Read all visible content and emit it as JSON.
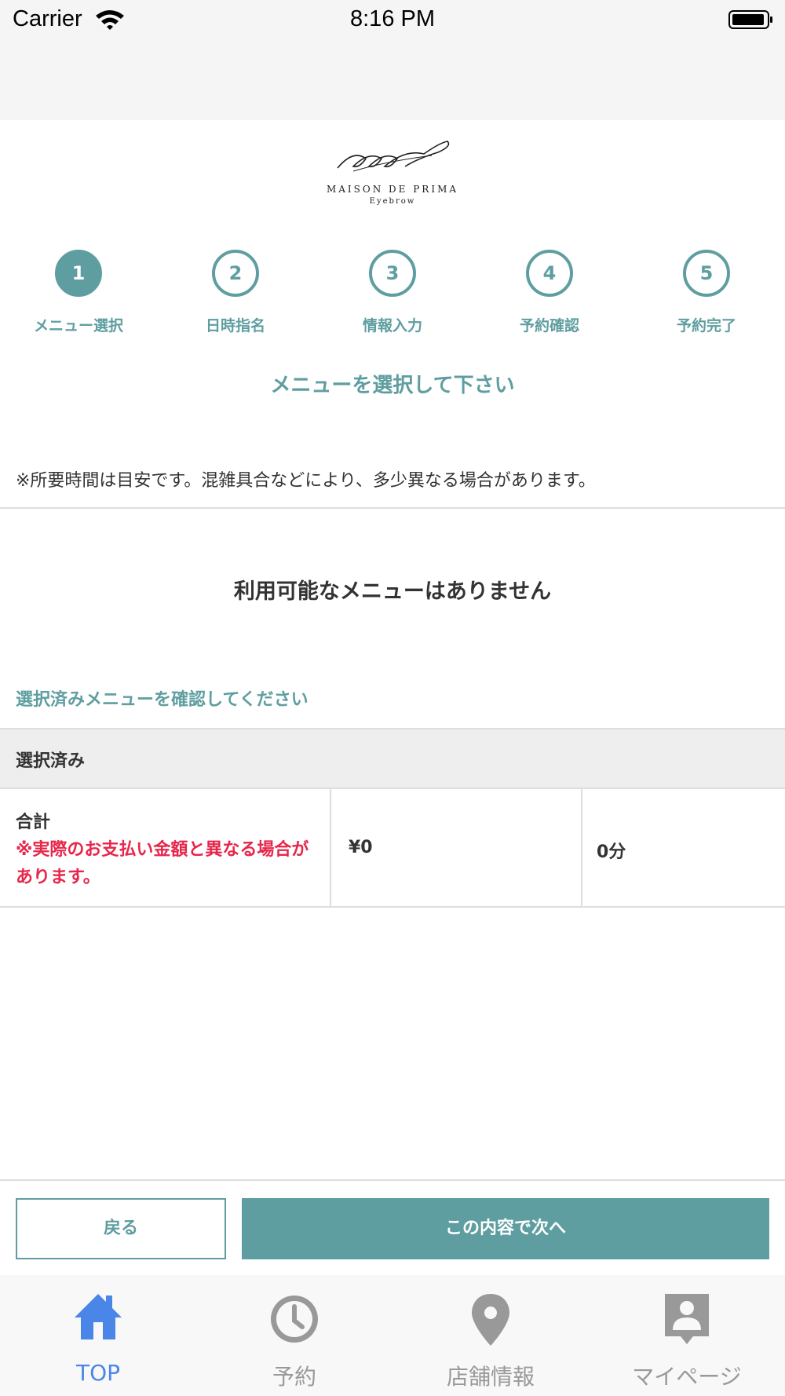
{
  "status_bar": {
    "carrier": "Carrier",
    "time": "8:16 PM"
  },
  "logo": {
    "brand": "MAISON DE PRIMA",
    "sub": "Eyebrow"
  },
  "steps": [
    {
      "number": "1",
      "label": "メニュー選択",
      "active": true
    },
    {
      "number": "2",
      "label": "日時指名",
      "active": false
    },
    {
      "number": "3",
      "label": "情報入力",
      "active": false
    },
    {
      "number": "4",
      "label": "予約確認",
      "active": false
    },
    {
      "number": "5",
      "label": "予約完了",
      "active": false
    }
  ],
  "main": {
    "title": "メニューを選択して下さい",
    "notice": "※所要時間は目安です。混雑具合などにより、多少異なる場合があります。",
    "empty_message": "利用可能なメニューはありません",
    "confirm_prompt": "選択済みメニューを確認してください"
  },
  "selected": {
    "header": "選択済み",
    "total_label": "合計",
    "total_warning": "※実際のお支払い金額と異なる場合があります。",
    "total_price": "¥0",
    "total_time": "0分"
  },
  "buttons": {
    "back": "戻る",
    "next": "この内容で次へ"
  },
  "tabs": [
    {
      "label": "TOP",
      "icon": "home-icon",
      "active": true
    },
    {
      "label": "予約",
      "icon": "clock-icon",
      "active": false
    },
    {
      "label": "店舗情報",
      "icon": "map-pin-icon",
      "active": false
    },
    {
      "label": "マイページ",
      "icon": "person-badge-icon",
      "active": false
    }
  ],
  "colors": {
    "accent": "#5f9ea0",
    "warning": "#e8254a",
    "tab_active": "#4a86e8",
    "tab_inactive": "#999999"
  }
}
